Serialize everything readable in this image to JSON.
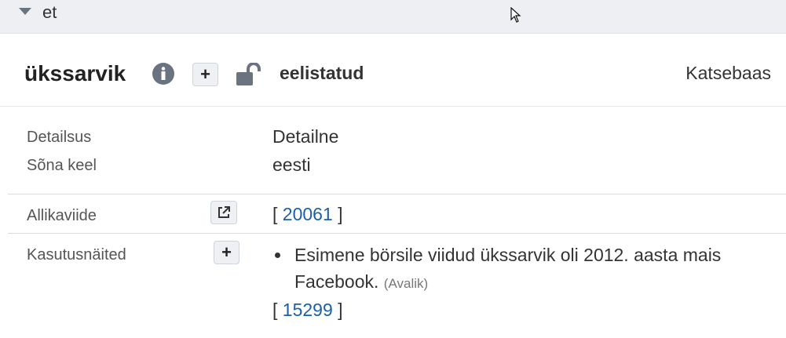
{
  "lang_section": {
    "lang_code": "et"
  },
  "header": {
    "word": "ükssarvik",
    "add_label": "+",
    "preferred_label": "eelistatud",
    "dataset_label": "Katsebaas"
  },
  "details": [
    {
      "label": "Detailsus",
      "value": "Detailne"
    },
    {
      "label": "Sõna keel",
      "value": "eesti"
    }
  ],
  "source_ref": {
    "label": "Allikaviide",
    "open": "[",
    "id": "20061",
    "close": "]"
  },
  "usage": {
    "label": "Kasutusnäited",
    "add_label": "+",
    "example_text": "Esimene börsile viidud ükssarvik oli 2012. aasta mais Facebook.",
    "visibility": "(Avalik)",
    "source_open": "[",
    "source_id": "15299",
    "source_close": "]"
  },
  "icons": [
    "caret-down-icon",
    "info-icon",
    "unlock-icon",
    "external-link-icon",
    "mouse-cursor-icon"
  ],
  "colors": {
    "topbar": "#edeff2",
    "link": "#1b5fa8",
    "button_bg": "#eef0f3"
  }
}
